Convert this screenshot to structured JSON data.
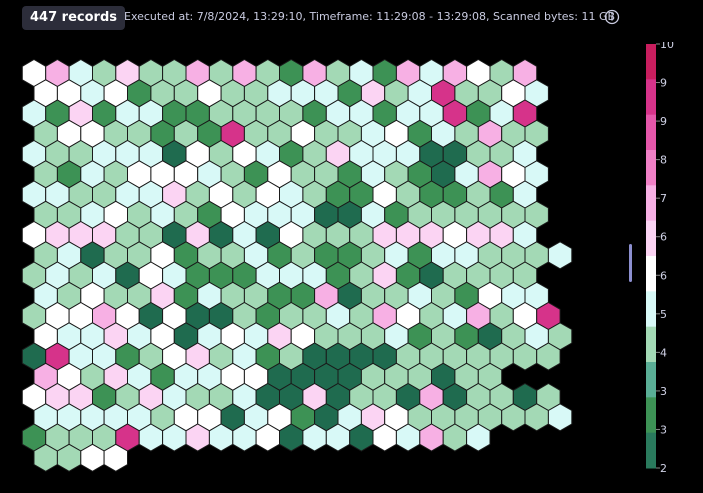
{
  "header": {
    "records_label": "447 records",
    "execution_info": "Executed at: 7/8/2024, 13:29:10, Timeframe: 11:29:08 - 13:29:08, Scanned bytes: 11 GB",
    "info_icon": "info-circle-icon"
  },
  "chart_data": {
    "type": "heatmap",
    "title": "",
    "record_count": 447,
    "legend": {
      "min": 2,
      "max": 10,
      "tick_labels": [
        "10",
        "9",
        "9",
        "8",
        "7",
        "6",
        "6",
        "5",
        "4",
        "3",
        "3",
        "2"
      ],
      "color_stops": [
        "#c81e5e",
        "#d6338a",
        "#e557aa",
        "#f080c6",
        "#f7b0e4",
        "#fbd4f3",
        "#ffffff",
        "#d8f9f7",
        "#a3d9b5",
        "#5aae96",
        "#3d9255",
        "#2a7a5d"
      ]
    },
    "rows": [
      "6854744848438453858648",
      "6656344644555374594465",
      "5373553344443553559359",
      "4664434394464456354844",
      "5445552646534755522445",
      "4354666543644354325865",
      "5544557464654336433435",
      "4456454365552253444444",
      "6777442725264447776775",
      "45244634453433453554445",
      "4545265333555347324444",
      "5464473544338244543655",
      "46686262243445486458469",
      "65575625657644453432454",
      "29553467453422224444444",
      "86475355662222444244",
      "67734754452272442824424",
      "55555466256325764444445",
      "34449557556255265845",
      "4466"
    ]
  },
  "colors": {
    "background": "#000000",
    "badge_background": "#2c2d3a",
    "hex_border": "#1a1a1a",
    "scrollbar": "#8c8fd0"
  }
}
